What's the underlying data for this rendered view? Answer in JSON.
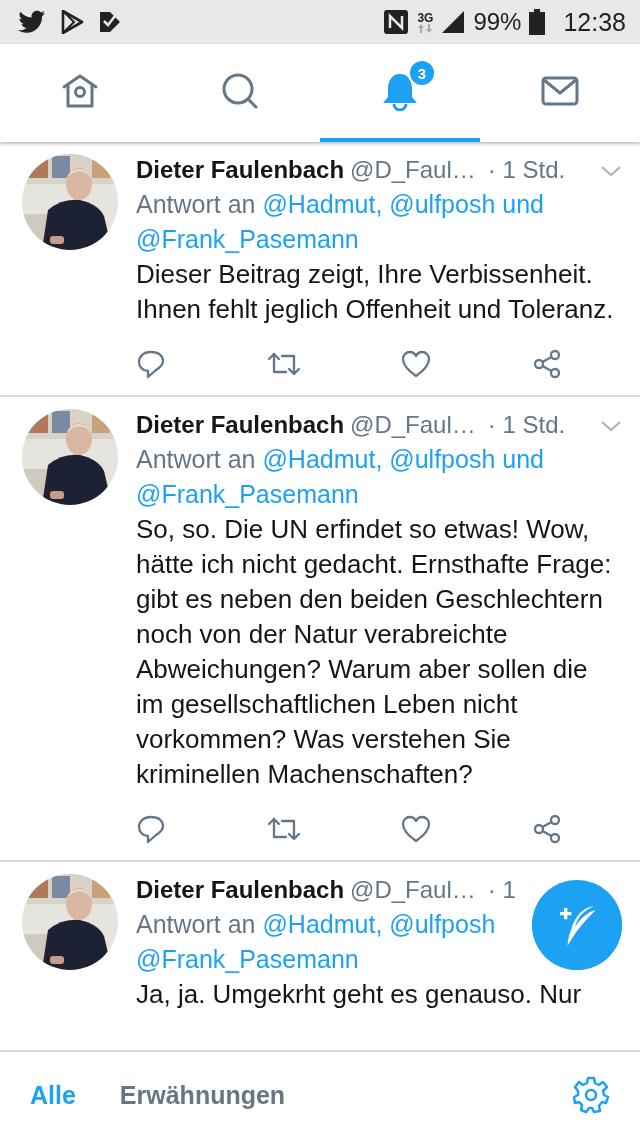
{
  "status_bar": {
    "network": "3G",
    "battery": "99%",
    "time": "12:38"
  },
  "nav_tabs": [
    {
      "kind": "home",
      "selected": false
    },
    {
      "kind": "search",
      "selected": false
    },
    {
      "kind": "notifications",
      "selected": true,
      "badge": "3"
    },
    {
      "kind": "messages",
      "selected": false
    }
  ],
  "tweets": [
    {
      "name": "Dieter Faulenbach",
      "handle": "@D_Faul…",
      "time": "· 1 Std.",
      "reply_prefix": "Antwort an",
      "mentions": [
        "@Hadmut,",
        "@ulfposh und",
        "@Frank_Pasemann"
      ],
      "text": "Dieser Beitrag zeigt, Ihre Verbissenheit. Ihnen fehlt jeglich Offenheit und Toleranz.",
      "actions": true
    },
    {
      "name": "Dieter Faulenbach",
      "handle": "@D_Faul…",
      "time": "· 1 Std.",
      "reply_prefix": "Antwort an",
      "mentions": [
        "@Hadmut,",
        "@ulfposh und",
        "@Frank_Pasemann"
      ],
      "text": "So, so. Die UN erfindet so etwas! Wow, hätte ich nicht gedacht. Ernsthafte Frage: gibt es neben den beiden Geschlechtern noch von der Natur verabreichte Abweichungen? Warum aber sollen die im gesellschaftlichen Leben nicht vorkommen? Was verstehen Sie kriminellen Machenschaften?",
      "actions": true
    },
    {
      "name": "Dieter Faulenbach",
      "handle": "@D_Faul…",
      "time": "· 1",
      "reply_prefix": "Antwort an",
      "mentions": [
        "@Hadmut,",
        "@ulfposh",
        "@Frank_Pasemann"
      ],
      "text": "Ja, ja. Umgekrht geht es genauso. Nur",
      "actions": false
    }
  ],
  "bottom_tabs": [
    {
      "label": "Alle",
      "selected": true
    },
    {
      "label": "Erwähnungen",
      "selected": false
    }
  ]
}
